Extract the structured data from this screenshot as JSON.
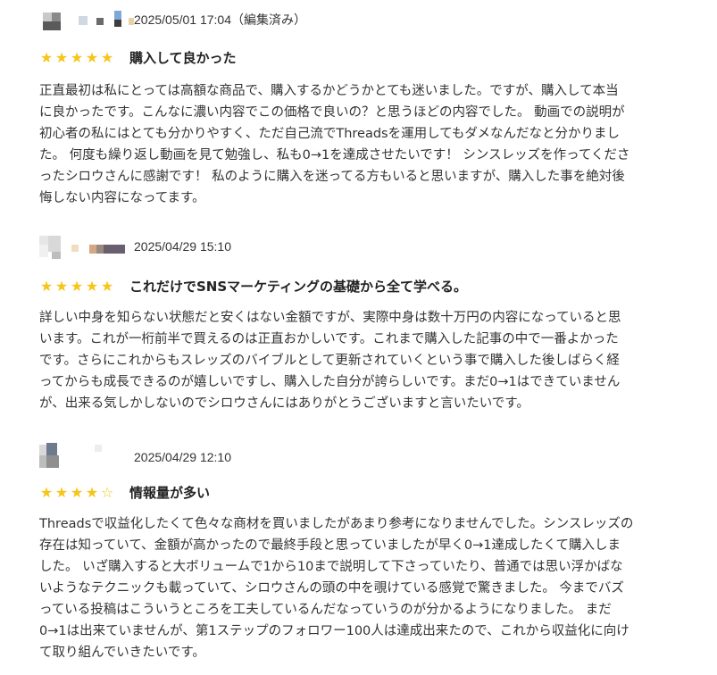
{
  "reviews": [
    {
      "date": "2025/05/01 17:04（編集済み）",
      "rating": 5,
      "stars": [
        "★",
        "★",
        "★",
        "★",
        "★"
      ],
      "title": "購入して良かった",
      "body": "正直最初は私にとっては高額な商品で、購入するかどうかとても迷いました。ですが、購入して本当\nに良かったです。こんなに濃い内容でこの価格で良いの？と思うほどの内容でした。 動画での説明が\n初心者の私にはとても分かりやすく、ただ自己流でThreadsを運用してもダメなんだなと分かりまし\nた。 何度も繰り返し動画を見て勉強し、私も0→1を達成させたいです！ シンスレッズを作ってくださ\nったシロウさんに感謝です！ 私のように購入を迷ってる方もいると思いますが、購入した事を絶対後\n悔しない内容になってます。"
    },
    {
      "date": "2025/04/29 15:10",
      "rating": 5,
      "stars": [
        "★",
        "★",
        "★",
        "★",
        "★"
      ],
      "title": "これだけでSNSマーケティングの基礎から全て学べる。",
      "body": "詳しい中身を知らない状態だと安くはない金額ですが、実際中身は数十万円の内容になっていると思\nいます。これが一桁前半で買えるのは正直おかしいです。これまで購入した記事の中で一番よかった\nです。さらにこれからもスレッズのバイブルとして更新されていくという事で購入した後しばらく経\nってからも成長できるのが嬉しいですし、購入した自分が誇らしいです。まだ0→1はできていません\nが、出来る気しかしないのでシロウさんにはありがとうございますと言いたいです。"
    },
    {
      "date": "2025/04/29 12:10",
      "rating": 4,
      "stars": [
        "★",
        "★",
        "★",
        "★",
        "☆"
      ],
      "title": "情報量が多い",
      "body": "Threadsで収益化したくて色々な商材を買いましたがあまり参考になりませんでした。シンスレッズの\n存在は知っていて、金額が高かったので最終手段と思っていましたが早く0→1達成したくて購入しま\nした。 いざ購入すると大ボリュームで1から10まで説明して下さっていたり、普通では思い浮かばな\nいようなテクニックも載っていて、シロウさんの頭の中を覗けている感覚で驚きました。 今までバズ\nっている投稿はこういうところを工夫しているんだなっていうのが分かるようになりました。 まだ\n0→1は出来ていませんが、第1ステップのフォロワー100人は達成出来たので、これから収益化に向け\nて取り組んでいきたいです。"
    }
  ],
  "colors": {
    "star": "#f5c518",
    "text": "#333333",
    "title": "#222222"
  }
}
